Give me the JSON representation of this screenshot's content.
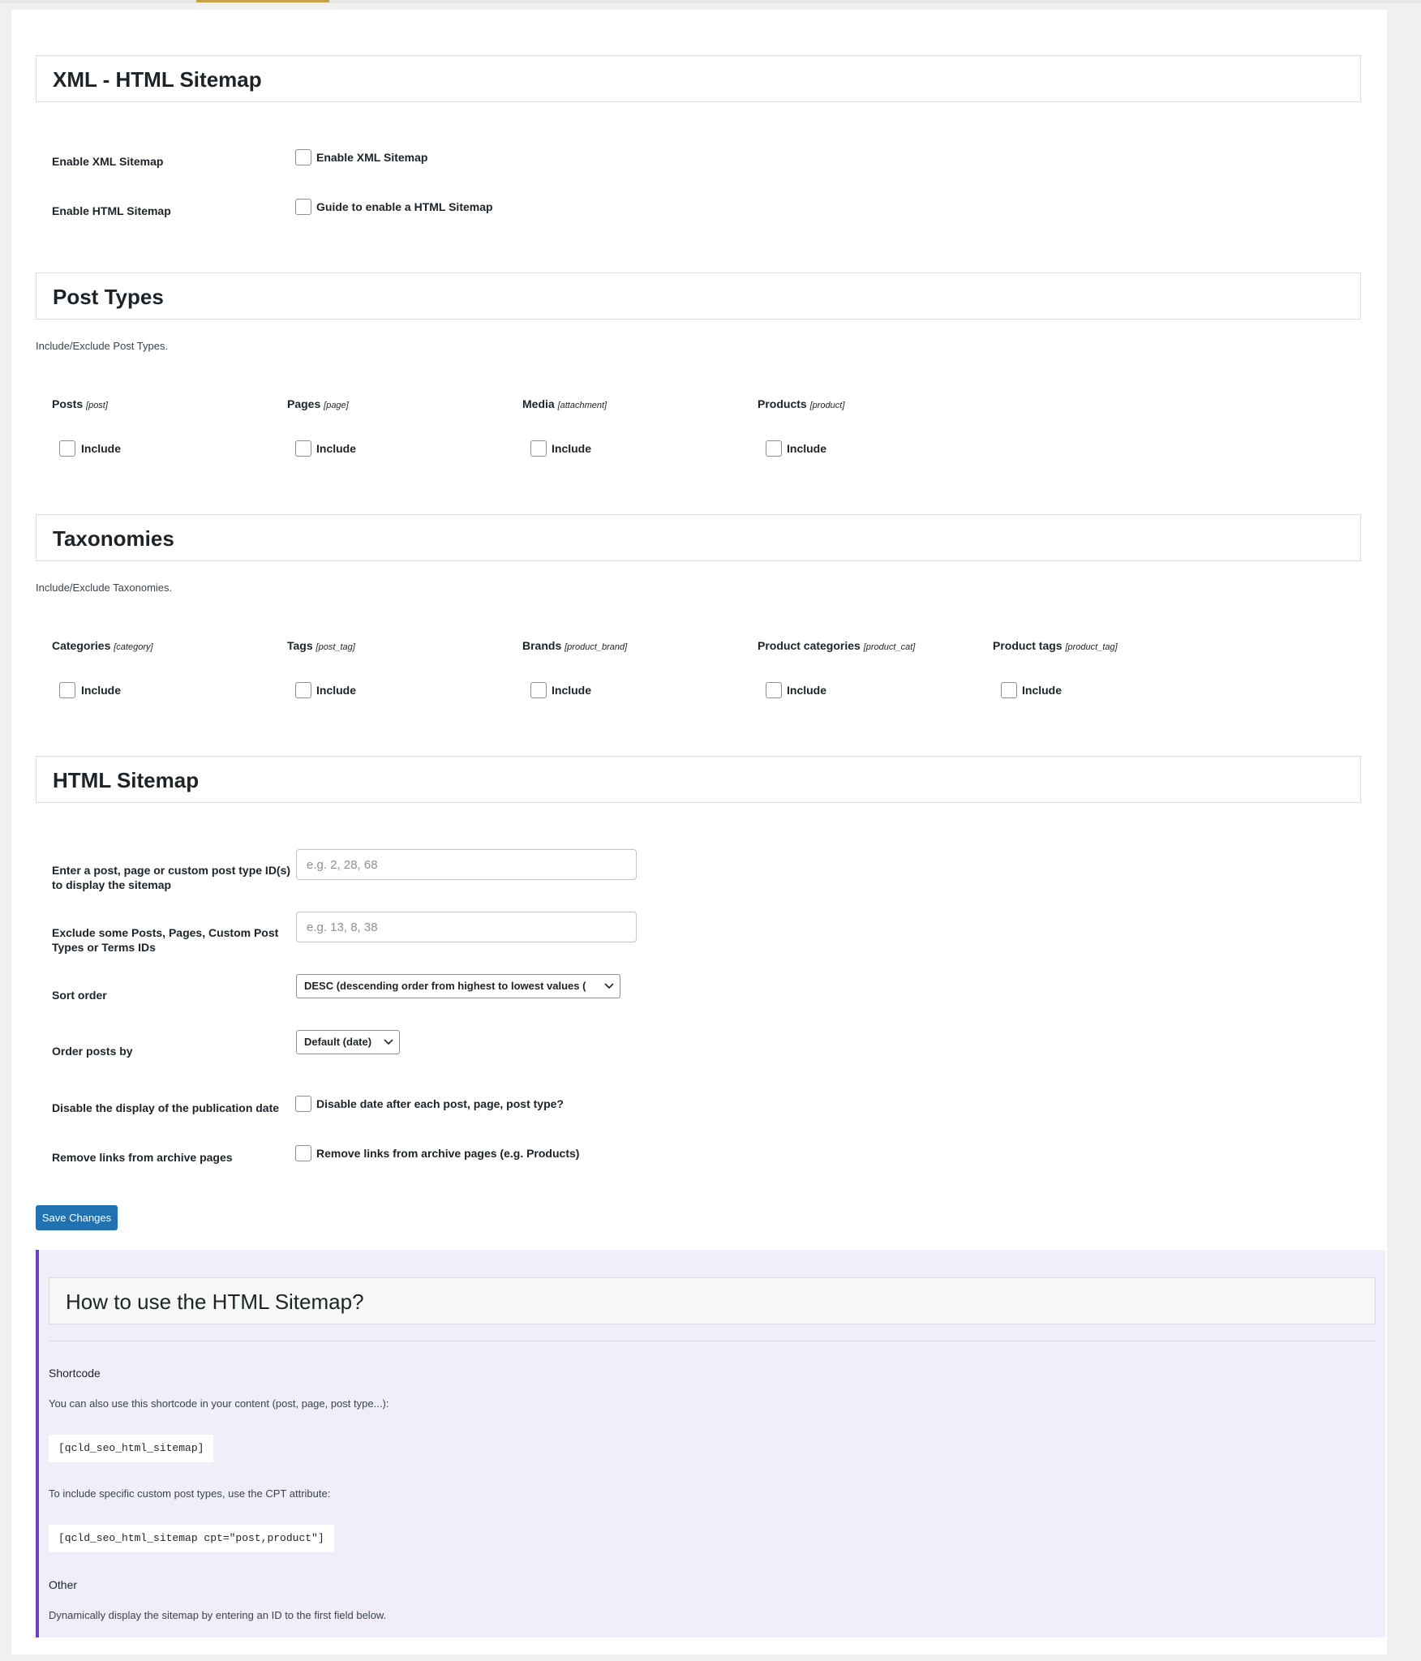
{
  "sections": {
    "xml_html": {
      "title": "XML - HTML Sitemap"
    },
    "post_types": {
      "title": "Post Types",
      "description": "Include/Exclude Post Types."
    },
    "taxonomies": {
      "title": "Taxonomies",
      "description": "Include/Exclude Taxonomies."
    },
    "html_sitemap": {
      "title": "HTML Sitemap"
    }
  },
  "xml_settings": [
    {
      "label": "Enable XML Sitemap",
      "checkbox_label": "Enable XML Sitemap",
      "checked": false
    },
    {
      "label": "Enable HTML Sitemap",
      "checkbox_label": "Guide to enable a HTML Sitemap",
      "checked": false
    }
  ],
  "post_types": [
    {
      "name": "Posts",
      "slug": "[post]",
      "include_label": "Include",
      "checked": false
    },
    {
      "name": "Pages",
      "slug": "[page]",
      "include_label": "Include",
      "checked": false
    },
    {
      "name": "Media",
      "slug": "[attachment]",
      "include_label": "Include",
      "checked": false
    },
    {
      "name": "Products",
      "slug": "[product]",
      "include_label": "Include",
      "checked": false
    }
  ],
  "taxonomies": [
    {
      "name": "Categories",
      "slug": "[category]",
      "include_label": "Include",
      "checked": false
    },
    {
      "name": "Tags",
      "slug": "[post_tag]",
      "include_label": "Include",
      "checked": false
    },
    {
      "name": "Brands",
      "slug": "[product_brand]",
      "include_label": "Include",
      "checked": false
    },
    {
      "name": "Product categories",
      "slug": "[product_cat]",
      "include_label": "Include",
      "checked": false
    },
    {
      "name": "Product tags",
      "slug": "[product_tag]",
      "include_label": "Include",
      "checked": false
    }
  ],
  "html_settings": {
    "ids_field": {
      "label_line1": "Enter a post, page or custom post type ID(s)",
      "label_line2": "to display the sitemap",
      "value": "",
      "placeholder": "e.g. 2, 28, 68"
    },
    "exclude_field": {
      "label_line1": "Exclude some Posts, Pages, Custom Post",
      "label_line2": "Types or Terms IDs",
      "value": "",
      "placeholder": "e.g. 13, 8, 38"
    },
    "sort_order": {
      "label": "Sort order",
      "selected": "DESC (descending order from highest to lowest values ("
    },
    "order_by": {
      "label": "Order posts by",
      "selected": "Default (date)"
    },
    "disable_date": {
      "label": "Disable the display of the publication date",
      "checkbox_label": "Disable date after each post, page, post type?",
      "checked": false
    },
    "remove_links": {
      "label": "Remove links from archive pages",
      "checkbox_label": "Remove links from archive pages (e.g. Products)",
      "checked": false
    }
  },
  "save_button": "Save Changes",
  "help": {
    "title": "How to use the HTML Sitemap?",
    "shortcode_heading": "Shortcode",
    "shortcode_text": "You can also use this shortcode in your content (post, page, post type...):",
    "shortcode_code": "[qcld_seo_html_sitemap]",
    "cpt_text": "To include specific custom post types, use the CPT attribute:",
    "cpt_code": "[qcld_seo_html_sitemap cpt=\"post,product\"]",
    "other_heading": "Other",
    "other_text": "Dynamically display the sitemap by entering an ID to the first field below."
  },
  "colors": {
    "primary_button": "#2271b1",
    "help_accent": "#6b3fc7",
    "help_background": "#f0eef8"
  }
}
